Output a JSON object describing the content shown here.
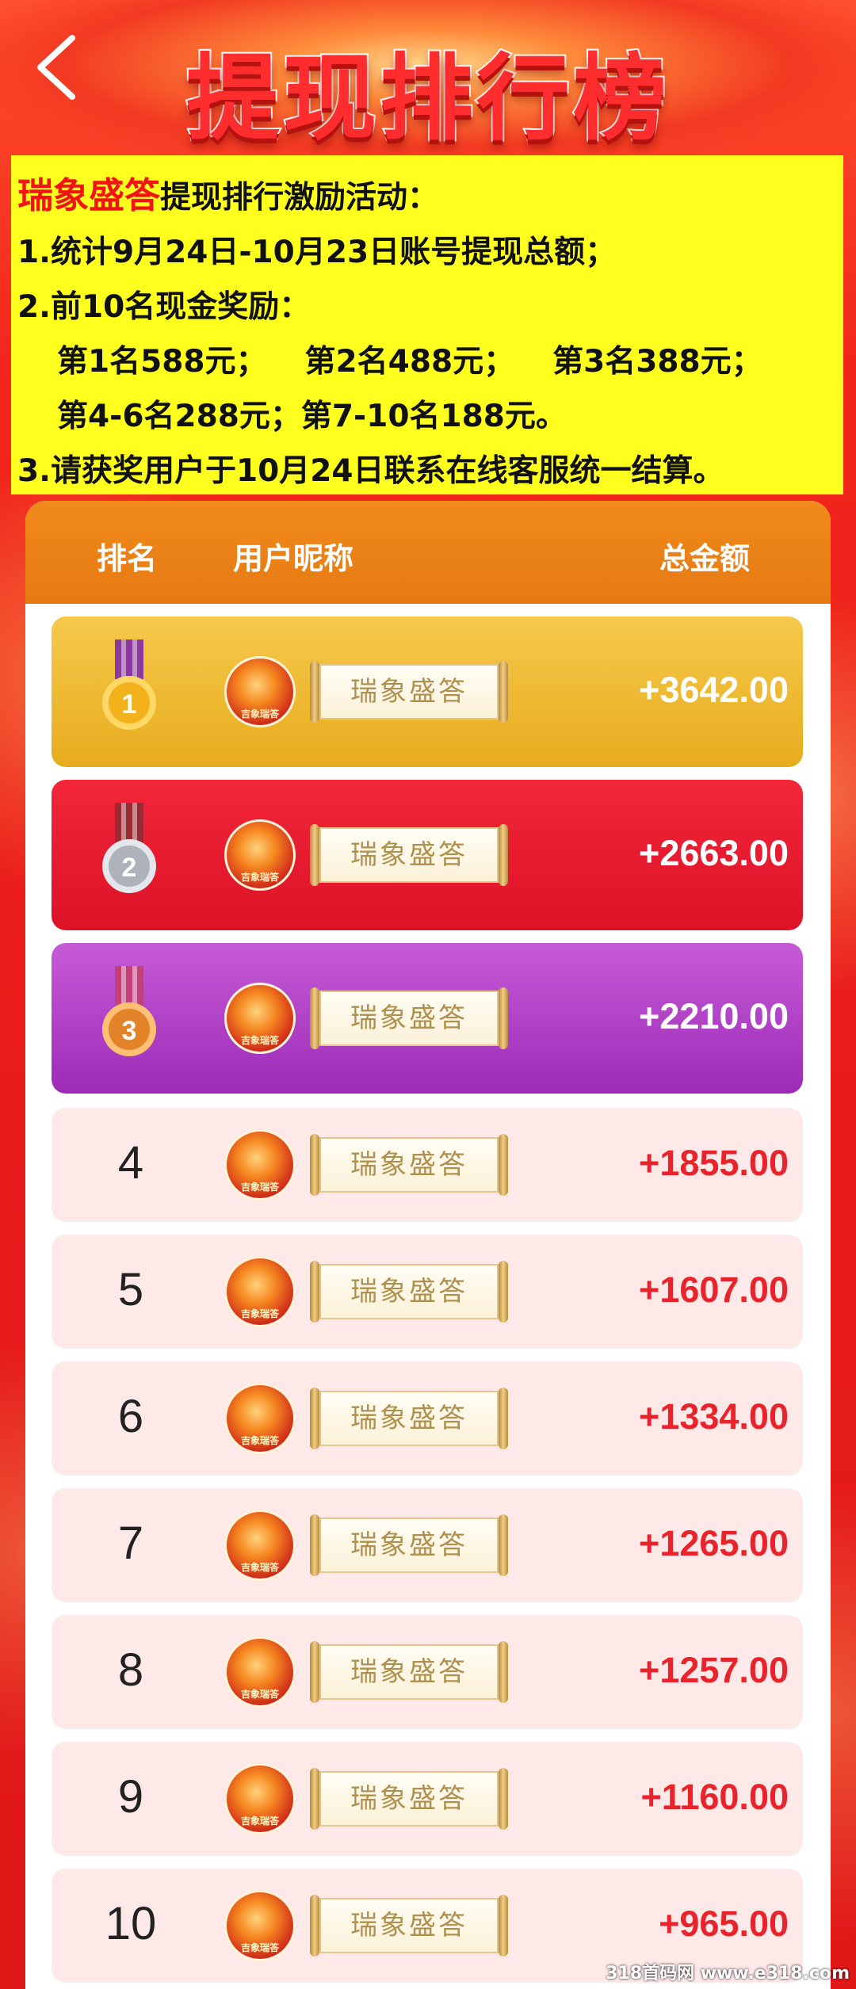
{
  "header": {
    "back_label": "back",
    "title": "提现排行榜"
  },
  "info": {
    "brand": "瑞象盛答",
    "headline": "提现排行激励活动：",
    "line1": "1.统计9月24日-10月23日账号提现总额；",
    "line2": "2.前10名现金奖励：",
    "prize_a": "第1名588元；",
    "prize_b": "第2名488元；",
    "prize_c": "第3名388元；",
    "prize_d": "第4-6名288元；第7-10名188元。",
    "line3": "3.请获奖用户于10月24日联系在线客服统一结算。"
  },
  "board": {
    "col_rank": "排名",
    "col_nickname": "用户昵称",
    "col_total": "总金额",
    "rows": [
      {
        "rank": "1",
        "nickname": "瑞象盛答",
        "amount": "+3642.00",
        "style": "gold",
        "medal": "gold-medal-icon"
      },
      {
        "rank": "2",
        "nickname": "瑞象盛答",
        "amount": "+2663.00",
        "style": "red",
        "medal": "silver-medal-icon"
      },
      {
        "rank": "3",
        "nickname": "瑞象盛答",
        "amount": "+2210.00",
        "style": "purple",
        "medal": "bronze-medal-icon"
      },
      {
        "rank": "4",
        "nickname": "瑞象盛答",
        "amount": "+1855.00",
        "style": "plain"
      },
      {
        "rank": "5",
        "nickname": "瑞象盛答",
        "amount": "+1607.00",
        "style": "plain"
      },
      {
        "rank": "6",
        "nickname": "瑞象盛答",
        "amount": "+1334.00",
        "style": "plain"
      },
      {
        "rank": "7",
        "nickname": "瑞象盛答",
        "amount": "+1265.00",
        "style": "plain"
      },
      {
        "rank": "8",
        "nickname": "瑞象盛答",
        "amount": "+1257.00",
        "style": "plain"
      },
      {
        "rank": "9",
        "nickname": "瑞象盛答",
        "amount": "+1160.00",
        "style": "plain"
      },
      {
        "rank": "10",
        "nickname": "瑞象盛答",
        "amount": "+965.00",
        "style": "plain"
      }
    ]
  },
  "avatar_caption": "吉象瑞答",
  "watermark": "318首码网 www.e318.com",
  "colors": {
    "background_red": "#e81b1b",
    "info_yellow": "#ffff1f",
    "brand_red": "#f01414",
    "header_orange": "#e57a12",
    "amount_red": "#e8232b",
    "row_pink": "#ffe8e8"
  }
}
